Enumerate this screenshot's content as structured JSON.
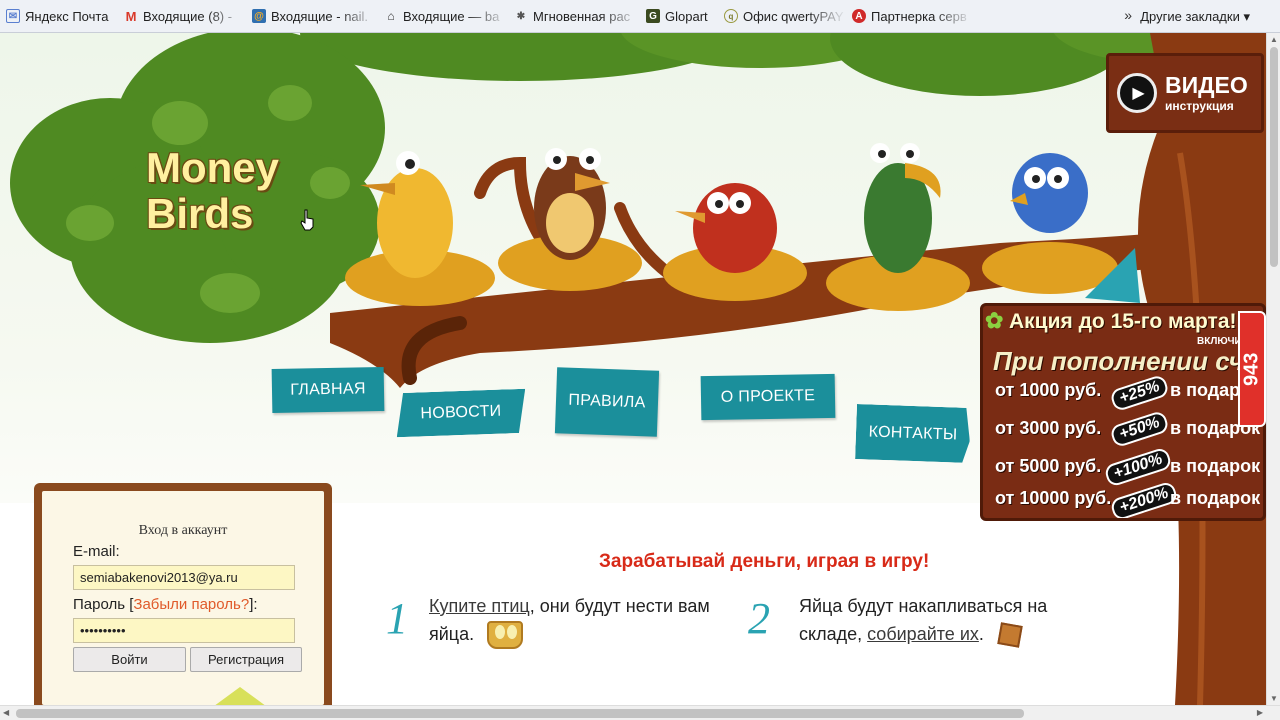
{
  "bookmarks": {
    "items": [
      {
        "label": "Яндекс Почта",
        "icon": "yandex-mail-icon"
      },
      {
        "label": "Входящие (8) - ",
        "icon": "gmail-icon"
      },
      {
        "label": "Входящие - nail.",
        "icon": "mail-ru-icon"
      },
      {
        "label": "Входящие — ba",
        "icon": "envelope-icon"
      },
      {
        "label": "Мгновенная рас",
        "icon": "puzzle-icon"
      },
      {
        "label": "Glopart",
        "icon": "glopart-icon"
      },
      {
        "label": "Офис qwertyPAY",
        "icon": "qwerty-icon"
      },
      {
        "label": "Партнерка серв",
        "icon": "a-icon"
      }
    ],
    "more": "»",
    "other": "Другие закладки"
  },
  "logo": {
    "line1": "Money",
    "line2": "Birds"
  },
  "nav": [
    "ГЛАВНАЯ",
    "НОВОСТИ",
    "ПРАВИЛА",
    "О ПРОЕКТЕ",
    "КОНТАКТЫ"
  ],
  "video": {
    "title": "ВИДЕО",
    "subtitle": "инструкция"
  },
  "promo": {
    "title": "Акция до 15-го марта!",
    "sub": "ВКЛЮЧИТЕ",
    "heading": "При пополнении сче",
    "rows": [
      {
        "amount": "от 1000 руб.",
        "bonus": "+25%",
        "gift": "в подарок"
      },
      {
        "amount": "от 3000 руб.",
        "bonus": "+50%",
        "gift": "в подарок"
      },
      {
        "amount": "от 5000 руб.",
        "bonus": "+100%",
        "gift": "в подарок"
      },
      {
        "amount": "от 10000 руб.",
        "bonus": "+200%",
        "gift": "в подарок"
      }
    ],
    "badge": "943"
  },
  "login": {
    "title": "Вход в аккаунт",
    "email_label": "E-mail:",
    "email_value": "semiabakenovi2013@ya.ru",
    "password_label_pre": "Пароль [",
    "forgot": "Забыли пароль?",
    "password_label_post": "]:",
    "password_value": "••••••••••",
    "login_button": "Войти",
    "register_button": "Регистрация"
  },
  "headline": "Зарабатывай деньги, играя в игру!",
  "steps": [
    {
      "num": "1",
      "link": "Купите птиц",
      "text1": ", они будут нести вам",
      "text2": "яйца."
    },
    {
      "num": "2",
      "text1": "Яйца будут накапливаться на",
      "text2pre": "складе, ",
      "link": "собирайте их",
      "text2post": "."
    }
  ],
  "colors": {
    "teal": "#1b8f9b",
    "brown": "#7a2c14",
    "red": "#d82a18",
    "foliage": "#5a8a2a"
  }
}
